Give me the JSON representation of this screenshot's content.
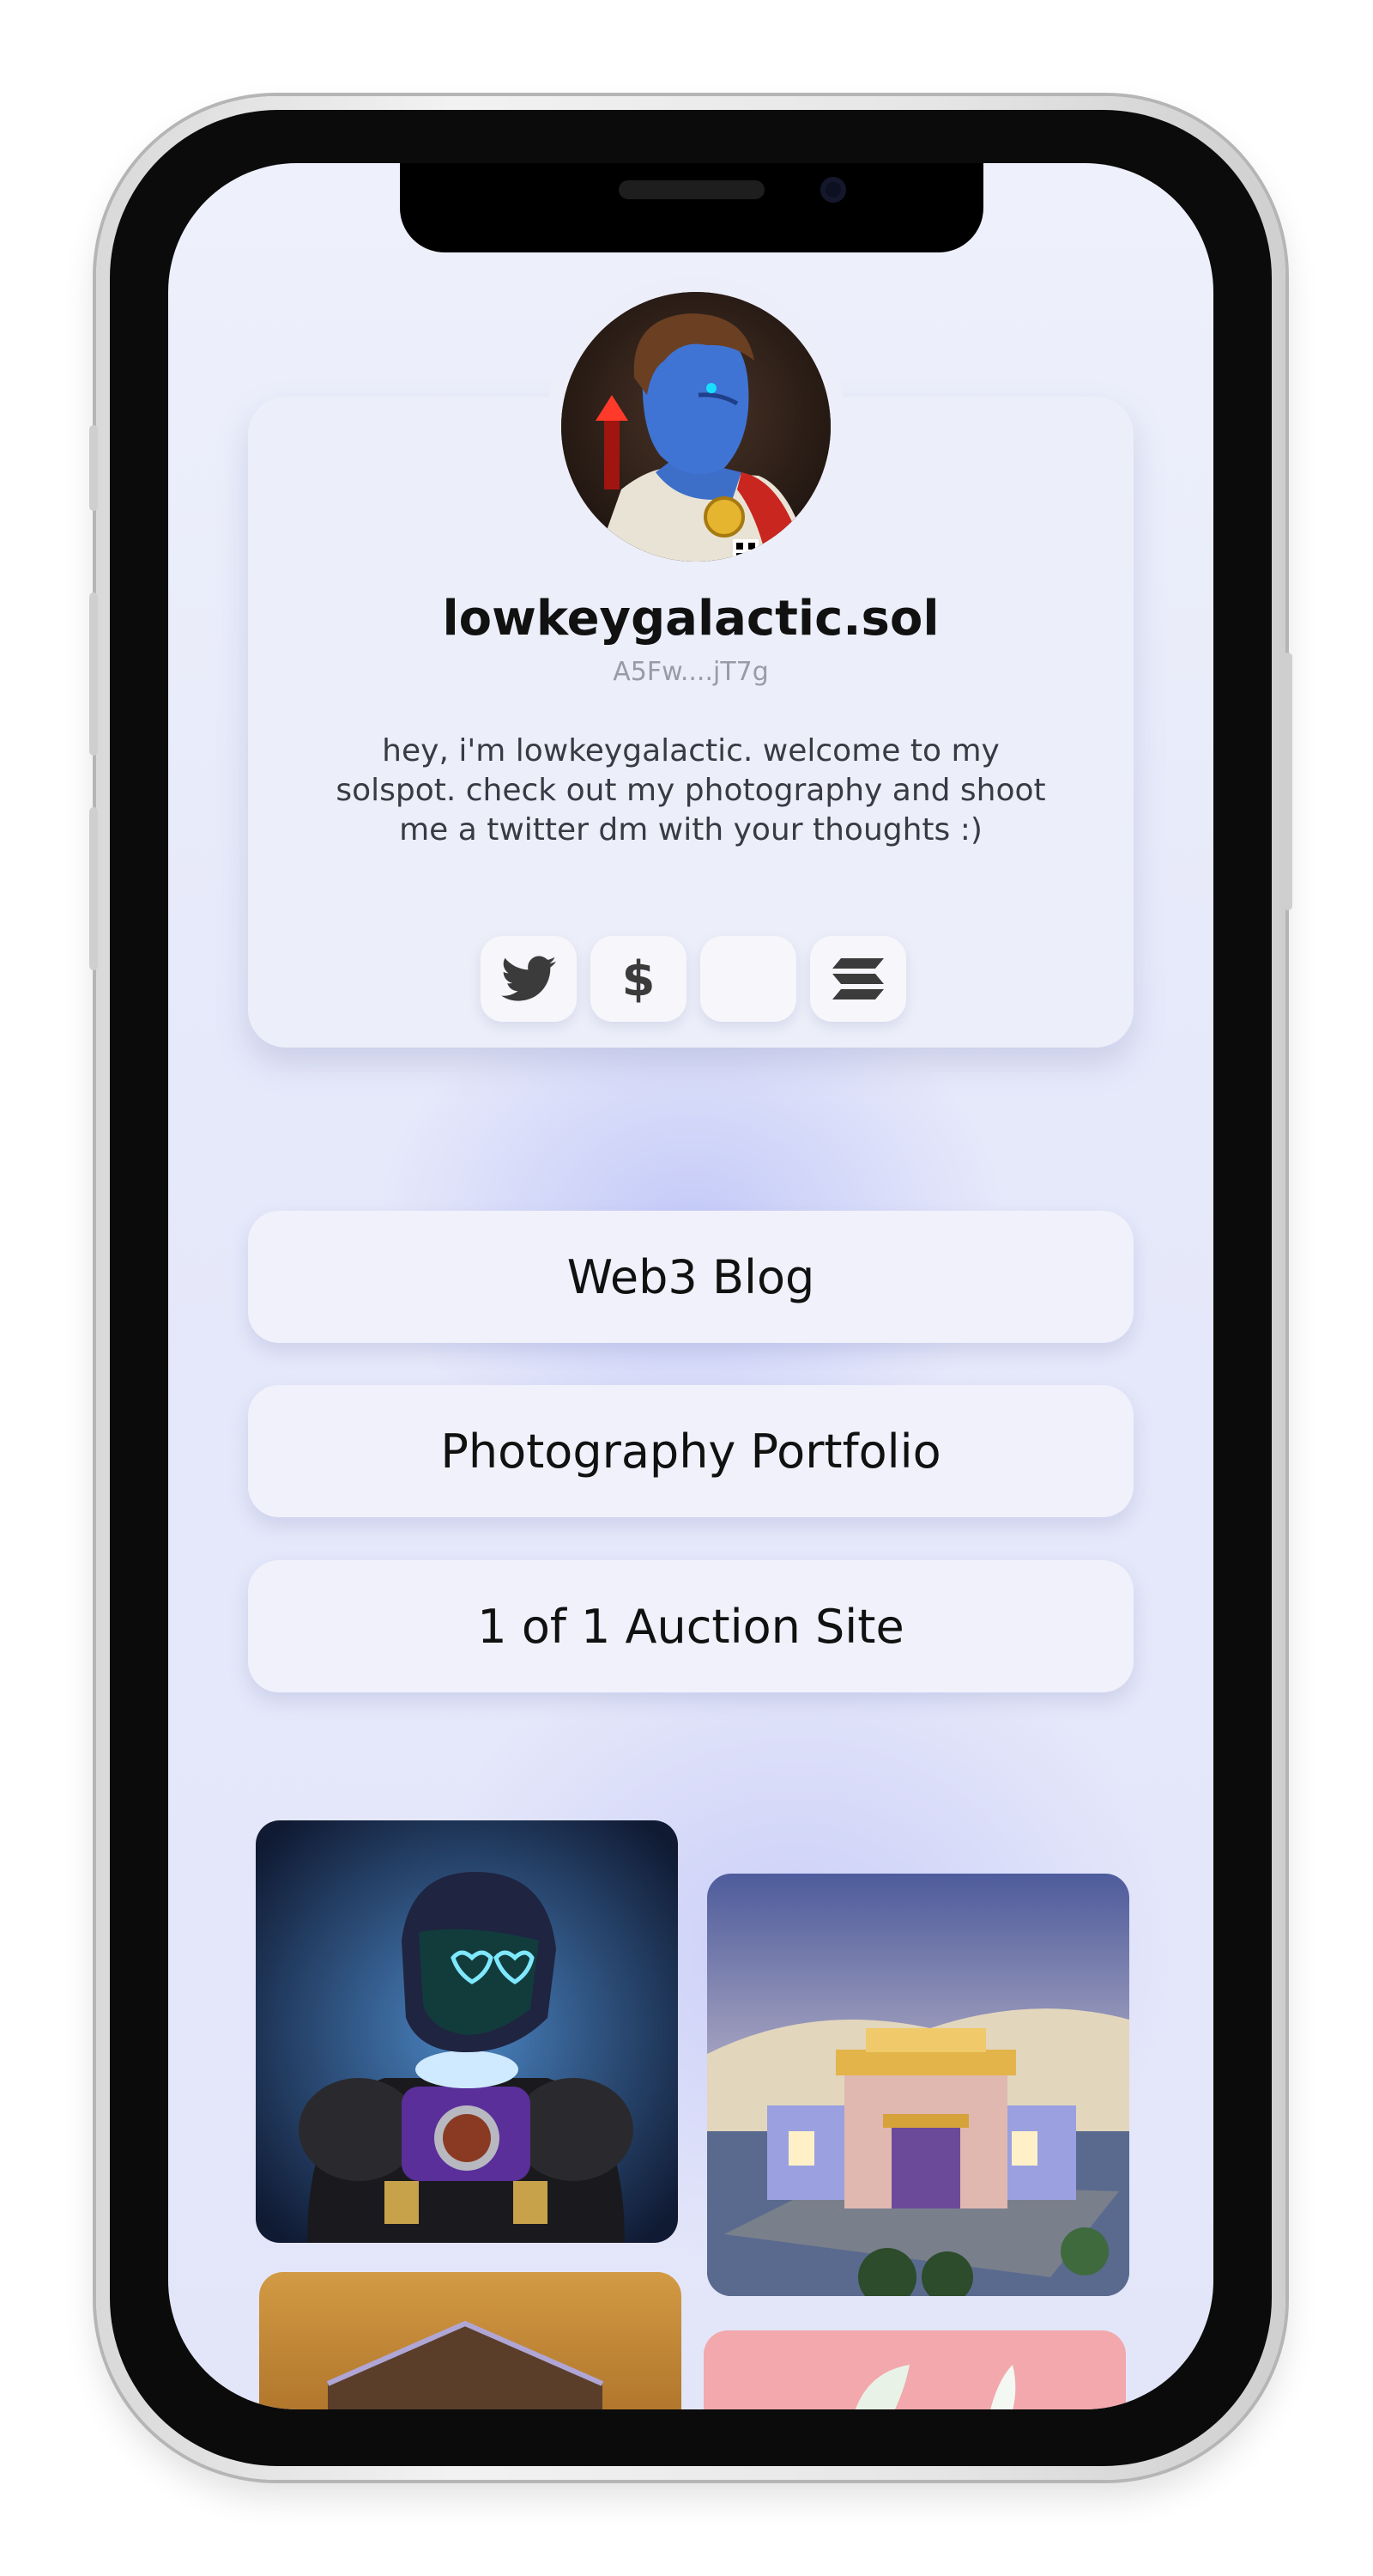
{
  "profile": {
    "username": "lowkeygalactic.sol",
    "wallet": "A5Fw....jT7g",
    "bio": "hey, i'm lowkeygalactic. welcome to my solspot. check out my photography and shoot me a twitter dm with your thoughts :)"
  },
  "social": [
    {
      "name": "twitter",
      "icon": "twitter-bird-icon"
    },
    {
      "name": "tip",
      "icon": "dollar-icon",
      "glyph": "$"
    },
    {
      "name": "blank",
      "icon": "blank-icon"
    },
    {
      "name": "solana",
      "icon": "solana-logo-icon"
    }
  ],
  "links": [
    {
      "label": "Web3 Blog"
    },
    {
      "label": "Photography Portfolio"
    },
    {
      "label": "1 of 1 Auction Site"
    }
  ],
  "gallery": [
    {
      "icon": "robot-astronaut-nft-image"
    },
    {
      "icon": "house-3d-nft-image"
    },
    {
      "icon": "orange-building-nft-image"
    },
    {
      "icon": "pink-plant-nft-image"
    }
  ],
  "colors": {
    "background": "#e6e9fa",
    "card": "#eceef9",
    "text": "#111111"
  }
}
